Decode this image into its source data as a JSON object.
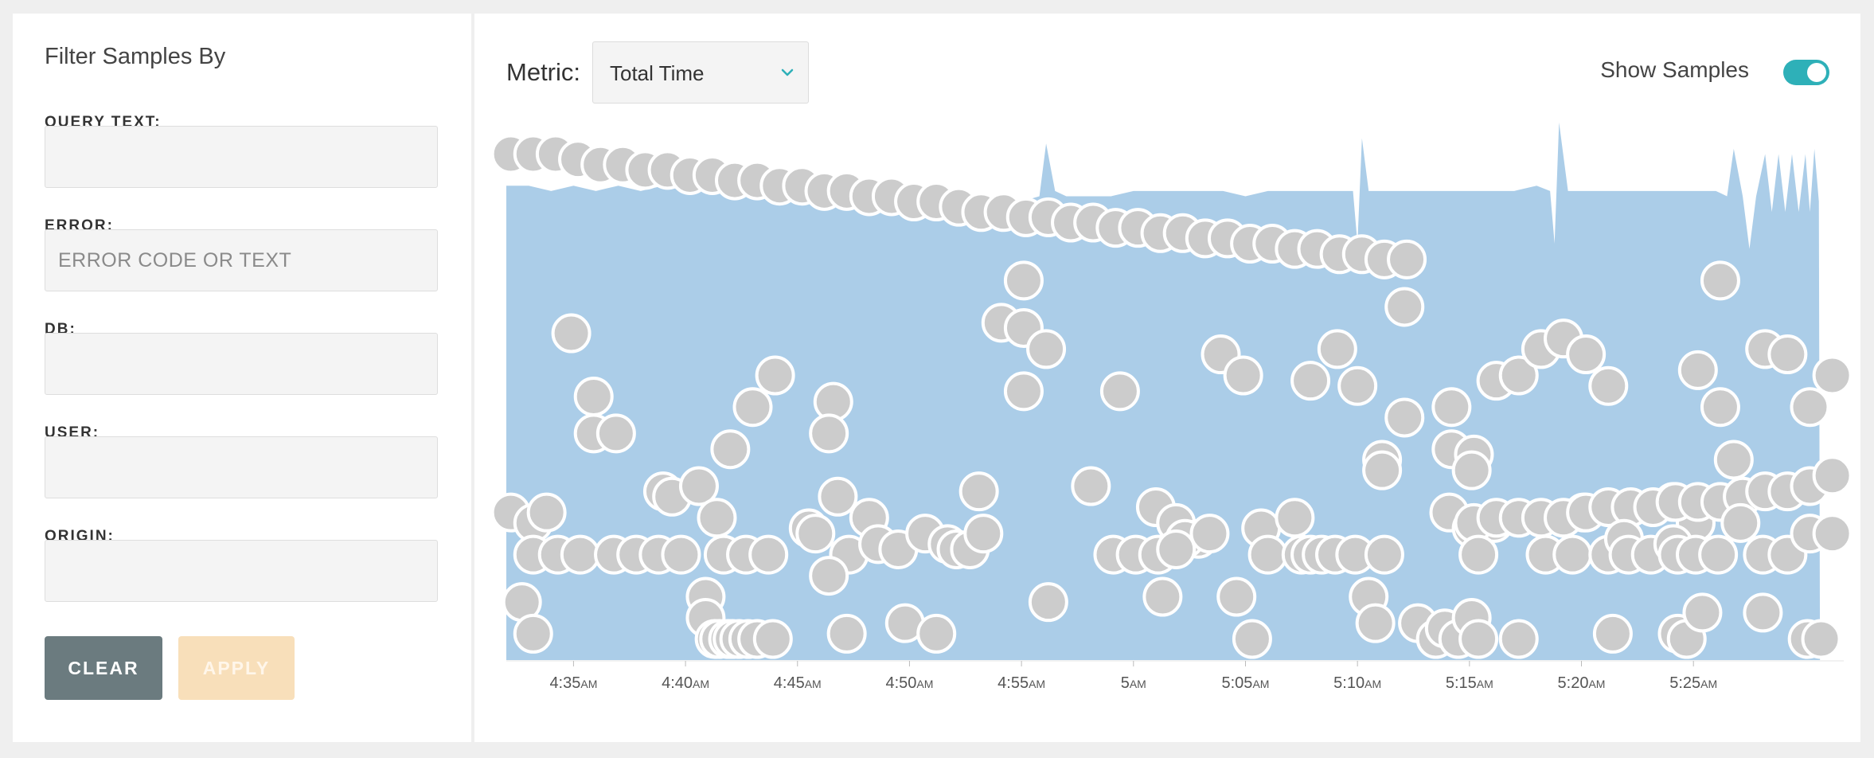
{
  "filters": {
    "title": "Filter Samples By",
    "query_text": {
      "label": "QUERY TEXT:",
      "value": "",
      "placeholder": ""
    },
    "error": {
      "label": "ERROR:",
      "value": "",
      "placeholder": "ERROR CODE OR TEXT"
    },
    "db": {
      "label": "DB:",
      "value": "",
      "placeholder": ""
    },
    "user": {
      "label": "USER:",
      "value": "",
      "placeholder": ""
    },
    "origin": {
      "label": "ORIGIN:",
      "value": "",
      "placeholder": ""
    },
    "clear_label": "CLEAR",
    "apply_label": "APPLY"
  },
  "toolbar": {
    "metric_label": "Metric:",
    "metric_value": "Total Time",
    "show_samples_label": "Show Samples",
    "show_samples_on": true,
    "accent_color": "#2eb0b8",
    "chevron_icon": "chevron-down-icon"
  },
  "chart_data": {
    "type": "scatter",
    "title": "",
    "xlabel": "",
    "ylabel": "",
    "x_unit": "minutes after 4:30 AM",
    "xlim": [
      2,
      61
    ],
    "ylim": [
      0,
      100
    ],
    "area_color": "#abcde8",
    "point_color": "#cccccc",
    "x_ticks": [
      {
        "t": 5,
        "main": "4:35",
        "suffix": "AM"
      },
      {
        "t": 10,
        "main": "4:40",
        "suffix": "AM"
      },
      {
        "t": 15,
        "main": "4:45",
        "suffix": "AM"
      },
      {
        "t": 20,
        "main": "4:50",
        "suffix": "AM"
      },
      {
        "t": 25,
        "main": "4:55",
        "suffix": "AM"
      },
      {
        "t": 30,
        "main": "5",
        "suffix": "AM"
      },
      {
        "t": 35,
        "main": "5:05",
        "suffix": "AM"
      },
      {
        "t": 40,
        "main": "5:10",
        "suffix": "AM"
      },
      {
        "t": 45,
        "main": "5:15",
        "suffix": "AM"
      },
      {
        "t": 50,
        "main": "5:20",
        "suffix": "AM"
      },
      {
        "t": 55,
        "main": "5:25",
        "suffix": "AM"
      }
    ],
    "area": [
      [
        2,
        90
      ],
      [
        3,
        90
      ],
      [
        4,
        89
      ],
      [
        5,
        90
      ],
      [
        6,
        89
      ],
      [
        7,
        90
      ],
      [
        8,
        89
      ],
      [
        9,
        90
      ],
      [
        10,
        89
      ],
      [
        11,
        90
      ],
      [
        12,
        89
      ],
      [
        13,
        89
      ],
      [
        14,
        89
      ],
      [
        15,
        88
      ],
      [
        16,
        88
      ],
      [
        17,
        88
      ],
      [
        18,
        88
      ],
      [
        19,
        87
      ],
      [
        20,
        87
      ],
      [
        21,
        87
      ],
      [
        22,
        86
      ],
      [
        23,
        86
      ],
      [
        24,
        87
      ],
      [
        25,
        87
      ],
      [
        25.8,
        88
      ],
      [
        26.1,
        98
      ],
      [
        26.5,
        89
      ],
      [
        27,
        88
      ],
      [
        28,
        88
      ],
      [
        29,
        88
      ],
      [
        30,
        89
      ],
      [
        31,
        89
      ],
      [
        32,
        89
      ],
      [
        33,
        89
      ],
      [
        34,
        89
      ],
      [
        35,
        88
      ],
      [
        36,
        89
      ],
      [
        37,
        89
      ],
      [
        38,
        89
      ],
      [
        39,
        89
      ],
      [
        39.8,
        89
      ],
      [
        40,
        79
      ],
      [
        40.2,
        99
      ],
      [
        40.5,
        89
      ],
      [
        41,
        89
      ],
      [
        42,
        89
      ],
      [
        43,
        89
      ],
      [
        44,
        89
      ],
      [
        45,
        89
      ],
      [
        46,
        89
      ],
      [
        47,
        89
      ],
      [
        48,
        90
      ],
      [
        48.6,
        89
      ],
      [
        48.8,
        79
      ],
      [
        49,
        102
      ],
      [
        49.4,
        89
      ],
      [
        50,
        89
      ],
      [
        51,
        89
      ],
      [
        52,
        89
      ],
      [
        53,
        89
      ],
      [
        54,
        89
      ],
      [
        55,
        89
      ],
      [
        56,
        89
      ],
      [
        56.5,
        88
      ],
      [
        56.8,
        97
      ],
      [
        57.2,
        88
      ],
      [
        57.5,
        78
      ],
      [
        57.8,
        88
      ],
      [
        58.2,
        96
      ],
      [
        58.5,
        85
      ],
      [
        58.8,
        96
      ],
      [
        59.1,
        85
      ],
      [
        59.4,
        96
      ],
      [
        59.7,
        85
      ],
      [
        60,
        96
      ],
      [
        60.2,
        85
      ],
      [
        60.4,
        97
      ],
      [
        60.6,
        87
      ],
      [
        60.65,
        0
      ]
    ],
    "points": [
      [
        2.2,
        96
      ],
      [
        3.2,
        96
      ],
      [
        4.2,
        96
      ],
      [
        5.2,
        95
      ],
      [
        6.2,
        94
      ],
      [
        7.2,
        94
      ],
      [
        8.2,
        93
      ],
      [
        9.2,
        93
      ],
      [
        10.2,
        92
      ],
      [
        11.2,
        92
      ],
      [
        12.2,
        91
      ],
      [
        13.2,
        91
      ],
      [
        14.2,
        90
      ],
      [
        15.2,
        90
      ],
      [
        16.2,
        89
      ],
      [
        17.2,
        89
      ],
      [
        18.2,
        88
      ],
      [
        19.2,
        88
      ],
      [
        20.2,
        87
      ],
      [
        21.2,
        87
      ],
      [
        22.2,
        86
      ],
      [
        23.2,
        85
      ],
      [
        24.2,
        85
      ],
      [
        25.2,
        84
      ],
      [
        26.2,
        84
      ],
      [
        27.2,
        83
      ],
      [
        28.2,
        83
      ],
      [
        29.2,
        82
      ],
      [
        30.2,
        82
      ],
      [
        31.2,
        81
      ],
      [
        32.2,
        81
      ],
      [
        33.2,
        80
      ],
      [
        34.2,
        80
      ],
      [
        35.2,
        79
      ],
      [
        36.2,
        79
      ],
      [
        37.2,
        78
      ],
      [
        38.2,
        78
      ],
      [
        39.2,
        77
      ],
      [
        40.2,
        77
      ],
      [
        41.2,
        76
      ],
      [
        42.2,
        76
      ],
      [
        4.9,
        62
      ],
      [
        5.9,
        50
      ],
      [
        5.9,
        43
      ],
      [
        6.9,
        43
      ],
      [
        14,
        54
      ],
      [
        13,
        48
      ],
      [
        12,
        40
      ],
      [
        16.6,
        49
      ],
      [
        16.4,
        43
      ],
      [
        25.1,
        72
      ],
      [
        24.1,
        64
      ],
      [
        25.1,
        63
      ],
      [
        26.1,
        59
      ],
      [
        25.1,
        51
      ],
      [
        29.4,
        51
      ],
      [
        33.9,
        58
      ],
      [
        34.9,
        54
      ],
      [
        37.9,
        53
      ],
      [
        40,
        52
      ],
      [
        42.1,
        67
      ],
      [
        39.1,
        59
      ],
      [
        44.2,
        48
      ],
      [
        44.2,
        40
      ],
      [
        45.2,
        39
      ],
      [
        46.2,
        53
      ],
      [
        47.2,
        54
      ],
      [
        48.2,
        59
      ],
      [
        49.2,
        61
      ],
      [
        50.2,
        58
      ],
      [
        51.2,
        52
      ],
      [
        56.2,
        72
      ],
      [
        56.2,
        48
      ],
      [
        56.8,
        38
      ],
      [
        55.2,
        55
      ],
      [
        58.2,
        59
      ],
      [
        59.2,
        58
      ],
      [
        60.2,
        48
      ],
      [
        61.2,
        54
      ],
      [
        42.1,
        46
      ],
      [
        41.1,
        38
      ],
      [
        41.1,
        36
      ],
      [
        44.1,
        28
      ],
      [
        45.1,
        25
      ],
      [
        45.1,
        36
      ],
      [
        46.1,
        26
      ],
      [
        50.1,
        28
      ],
      [
        54.1,
        30
      ],
      [
        55.1,
        26
      ],
      [
        2.2,
        28
      ],
      [
        3.2,
        26
      ],
      [
        3.8,
        28
      ],
      [
        3.2,
        20
      ],
      [
        4.3,
        20
      ],
      [
        5.3,
        20
      ],
      [
        6.8,
        20
      ],
      [
        7.8,
        20
      ],
      [
        8.8,
        20
      ],
      [
        9.8,
        20
      ],
      [
        11.7,
        20
      ],
      [
        12.7,
        20
      ],
      [
        13.7,
        20
      ],
      [
        9,
        32
      ],
      [
        9.4,
        31
      ],
      [
        10.6,
        33
      ],
      [
        11.4,
        27
      ],
      [
        15.5,
        25
      ],
      [
        15.8,
        24
      ],
      [
        16.8,
        31
      ],
      [
        17.3,
        20
      ],
      [
        16.4,
        16
      ],
      [
        18.2,
        27
      ],
      [
        18.6,
        22
      ],
      [
        19.5,
        21
      ],
      [
        20.7,
        24
      ],
      [
        21.7,
        22
      ],
      [
        22.1,
        21
      ],
      [
        22.7,
        21
      ],
      [
        23.1,
        32
      ],
      [
        23.3,
        24
      ],
      [
        28.1,
        33
      ],
      [
        31,
        29
      ],
      [
        31.9,
        26
      ],
      [
        32.9,
        23
      ],
      [
        32.3,
        23
      ],
      [
        33.4,
        24
      ],
      [
        29.1,
        20
      ],
      [
        30.1,
        20
      ],
      [
        31.1,
        20
      ],
      [
        31.9,
        21
      ],
      [
        35.7,
        25
      ],
      [
        36,
        20
      ],
      [
        37.2,
        27
      ],
      [
        37.5,
        20
      ],
      [
        37.9,
        20
      ],
      [
        38.4,
        20
      ],
      [
        39,
        20
      ],
      [
        39.9,
        20
      ],
      [
        41.2,
        20
      ],
      [
        45.2,
        26
      ],
      [
        46.2,
        27
      ],
      [
        47.2,
        27
      ],
      [
        48.2,
        27
      ],
      [
        49.2,
        27
      ],
      [
        50.2,
        28
      ],
      [
        51.2,
        29
      ],
      [
        52.2,
        29
      ],
      [
        53.2,
        29
      ],
      [
        54.2,
        30
      ],
      [
        55.2,
        30
      ],
      [
        56.2,
        30
      ],
      [
        57.2,
        31
      ],
      [
        58.2,
        32
      ],
      [
        59.2,
        32
      ],
      [
        60.2,
        33
      ],
      [
        61.2,
        35
      ],
      [
        45.4,
        20
      ],
      [
        48.4,
        20
      ],
      [
        49.6,
        20
      ],
      [
        51.2,
        20
      ],
      [
        51.9,
        23
      ],
      [
        52.1,
        20
      ],
      [
        53.1,
        20
      ],
      [
        54.1,
        22
      ],
      [
        54.3,
        20
      ],
      [
        55.1,
        20
      ],
      [
        56.1,
        20
      ],
      [
        57.1,
        26
      ],
      [
        58.1,
        20
      ],
      [
        59.2,
        20
      ],
      [
        60.2,
        24
      ],
      [
        61.2,
        24
      ],
      [
        2.7,
        11
      ],
      [
        3.2,
        5
      ],
      [
        10.9,
        12
      ],
      [
        10.9,
        8
      ],
      [
        11.3,
        4
      ],
      [
        11.5,
        4
      ],
      [
        11.9,
        4
      ],
      [
        12.1,
        4
      ],
      [
        12.4,
        4
      ],
      [
        12.8,
        4
      ],
      [
        13.2,
        4
      ],
      [
        13.9,
        4
      ],
      [
        17.2,
        5
      ],
      [
        19.8,
        7
      ],
      [
        21.2,
        5
      ],
      [
        26.2,
        11
      ],
      [
        31.3,
        12
      ],
      [
        34.6,
        12
      ],
      [
        35.3,
        4
      ],
      [
        40.5,
        12
      ],
      [
        40.8,
        7
      ],
      [
        42.7,
        7
      ],
      [
        43.5,
        4
      ],
      [
        43.9,
        6
      ],
      [
        44.5,
        4
      ],
      [
        45.1,
        8
      ],
      [
        45.4,
        4
      ],
      [
        47.2,
        4
      ],
      [
        51.4,
        5
      ],
      [
        54.3,
        5
      ],
      [
        54.7,
        4
      ],
      [
        55.4,
        9
      ],
      [
        58.1,
        9
      ],
      [
        60.1,
        4
      ],
      [
        60.7,
        4
      ]
    ]
  }
}
